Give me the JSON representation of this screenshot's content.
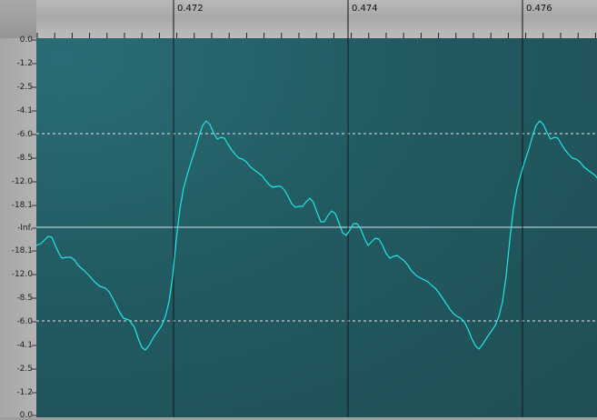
{
  "time_ruler": {
    "labels": [
      "0.472",
      "0.474",
      "0.476"
    ]
  },
  "level_scale": {
    "labels": [
      "0.0",
      "-1.2",
      "-2.5",
      "-4.1",
      "-6.0",
      "-8.5",
      "-12.0",
      "-18.1",
      "-Inf.",
      "-18.1",
      "-12.0",
      "-8.5",
      "-6.0",
      "-4.1",
      "-2.5",
      "-1.2",
      "0.0"
    ]
  },
  "colors": {
    "waveform": "#22e6e6",
    "center_line": "#cfe7ea",
    "grid_dashed": "#e6e6e6",
    "marker_line": "#0e0e0e"
  }
}
